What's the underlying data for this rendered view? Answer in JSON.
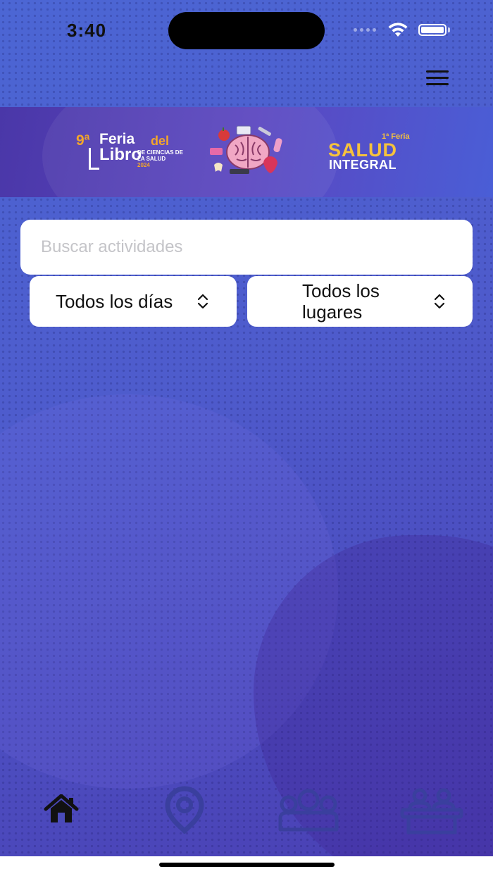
{
  "status_bar": {
    "time": "3:40"
  },
  "header": {
    "menu_icon": "hamburger-menu-icon"
  },
  "banner": {
    "left_logo": {
      "number": "9ª",
      "word1": "Feria",
      "word2": "del",
      "word3": "Libro",
      "subtitle": "DE CIENCIAS DE LA SALUD",
      "year": "2024"
    },
    "center_logo": "brain-illustration",
    "right_logo": {
      "kicker": "1ª Feria",
      "title": "SALUD",
      "subtitle": "INTEGRAL"
    }
  },
  "search": {
    "placeholder": "Buscar actividades",
    "value": ""
  },
  "filters": {
    "days": {
      "label": "Todos los días",
      "icon": "chevron-up-down-icon"
    },
    "places": {
      "label": "Todos los lugares",
      "icon": "chevron-up-down-icon"
    }
  },
  "tabs": [
    {
      "icon": "home-icon",
      "active": true
    },
    {
      "icon": "location-pin-icon",
      "active": false
    },
    {
      "icon": "group-icon",
      "active": false
    },
    {
      "icon": "presenters-table-icon",
      "active": false
    }
  ],
  "colors": {
    "background_top": "#4c66d4",
    "background_bottom": "#4a3fb3",
    "accent_orange": "#f3a62a",
    "accent_yellow": "#f6c23c",
    "inactive_tab_icon": "#3a3f9e",
    "active_tab_icon": "#111111"
  }
}
